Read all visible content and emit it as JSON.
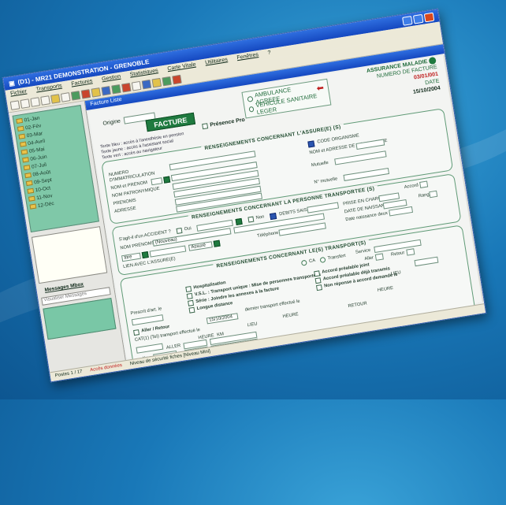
{
  "window": {
    "title": "(D1) - MR21 DEMONSTRATION - GRENOBLE",
    "icon": "app-icon"
  },
  "menu": [
    {
      "label": "Fichier"
    },
    {
      "label": "Transports"
    },
    {
      "label": "Factures"
    },
    {
      "label": "Gestion"
    },
    {
      "label": "Statistiques"
    },
    {
      "label": "Carte Vitale"
    },
    {
      "label": "Utilitaires"
    },
    {
      "label": "Fenêtres"
    },
    {
      "label": "?"
    }
  ],
  "tree": [
    "01-Jan",
    "02-Fév",
    "03-Mar",
    "04-Avril",
    "05-Mai",
    "06-Juin",
    "07-Juil",
    "08-Août",
    "09-Sept",
    "10-Oct",
    "11-Nov",
    "12-Déc"
  ],
  "left_panel": {
    "messages_title": "Messages Mbox",
    "messages_select": "Visualiser Messages"
  },
  "child_window": {
    "title": "Facture Liste"
  },
  "form": {
    "origine_label": "Origine",
    "facture_label": "FACTURE",
    "transport_ambulance": "AMBULANCE AGREEE",
    "transport_vsl": "VEHICULE SANITAIRE LEGER",
    "assurance_label": "ASSURANCE MALADIE",
    "numero_label": "NUMERO DE FACTURE",
    "numero_value": "03/01/001",
    "date_label": "DATE",
    "date_value": "15/10/2004",
    "presence_label": "Présence Pro",
    "notes": [
      "Texte bleu : accès à l'anesthésie en pension",
      "Texte jaune : accès à l'assistant social",
      "Texte vert : accès au navigateur"
    ],
    "assure": {
      "title": "RENSEIGNEMENTS CONCERNANT L'ASSURE(E) (S)",
      "code_organisme": "CODE ORGANISME",
      "nom_adresse": "NOM et ADRESSE DE L'ORGANISME",
      "mutuelle": "Mutuelle",
      "numero": "NUMERO",
      "immatriculation": "D'IMMATRICULATION",
      "nom_prenom": "NOM et PRENOM",
      "nom_patronymique": "NOM PATRONYMIQUE",
      "prenoms": "PRENOMS",
      "adresse": "ADRESSE",
      "n_mutuelle": "N° mutuelle",
      "titre": "titre"
    },
    "personne": {
      "title": "RENSEIGNEMENTS CONCERNANT LA PERSONNE TRANSPORTEE (S)",
      "accident": "S'agit-il d'un ACCIDENT ?",
      "oui": "Oui",
      "non": "Non",
      "debits": "DEBITS SAISIR",
      "prise_en_charge": "PRISE EN CHARGE",
      "date_naissance": "DATE DE NAISSANCE",
      "date_naissance_2": "Date naissance deux",
      "rang": "Rang",
      "accord": "Accord",
      "nom_prenom": "NOM PRENOMS",
      "nom_value": "(Nouveau)",
      "lien": "LIEN AVEC L'ASSURE(E)",
      "lien_value": "Assuré",
      "telephone": "Téléphone",
      "titre_value": "titre"
    },
    "transports": {
      "title": "RENSEIGNEMENTS CONCERNANT LE(S) TRANSPORT(S)",
      "ca": "CA",
      "transfert": "Transfert",
      "service": "Service",
      "aller": "Aller",
      "retour": "Retour",
      "options": [
        "Hospitalisation",
        "V.S.L. : Transport unique : Mise de personnes transportées",
        "Série : Joindre les annexes à la facture",
        "Longue distance"
      ],
      "accords": [
        "Accord préalable joint",
        "Accord préalable déjà transmis",
        "Non réponse à accord demandé le"
      ],
      "prescrit": "Prescrit d'art. le",
      "aller_retour": "Aller / Retour",
      "date_transport": "15/10/2004",
      "dernier_transport": "dernier transport effectué le",
      "cat": "CAT(1) (Tel) transport effectué le",
      "heure": "HEURE",
      "km": "KM",
      "lieu": "LIEU",
      "heure2": "HEURE",
      "lieu2": "LIEU",
      "heure3": "HEURE",
      "aller_label": "ALLER",
      "retour_label": "RETOUR",
      "kms": "Kms"
    }
  },
  "status": {
    "postes": "Postes 1 / 17",
    "acces": "Accès données",
    "niveau": "Niveau de sécurité fiches [Niveau Mini]"
  }
}
